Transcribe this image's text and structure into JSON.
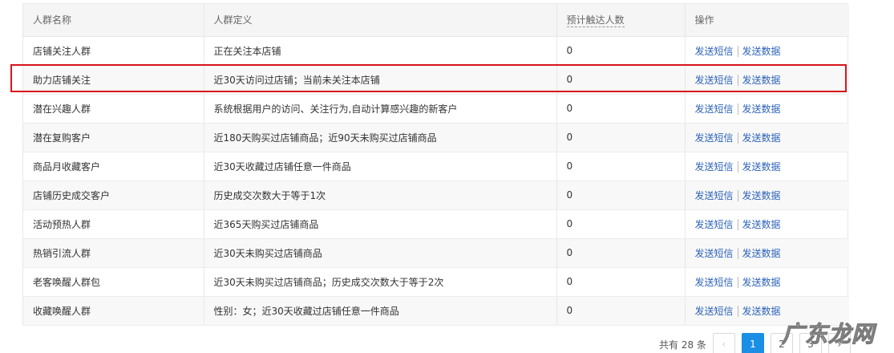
{
  "table": {
    "headers": {
      "name": "人群名称",
      "definition": "人群定义",
      "reach": "预计触达人数",
      "actions": "操作"
    },
    "rows": [
      {
        "name": "店铺关注人群",
        "definition": "正在关注本店铺",
        "reach": "0",
        "sms": "发送短信",
        "data": "发送数据"
      },
      {
        "name": "助力店铺关注",
        "definition": "近30天访问过店铺；当前未关注本店铺",
        "reach": "0",
        "sms": "发送短信",
        "data": "发送数据"
      },
      {
        "name": "潜在兴趣人群",
        "definition": "系统根据用户的访问、关注行为,自动计算感兴趣的新客户",
        "reach": "0",
        "sms": "发送短信",
        "data": "发送数据"
      },
      {
        "name": "潜在复购客户",
        "definition": "近180天购买过店铺商品；近90天未购买过店铺商品",
        "reach": "0",
        "sms": "发送短信",
        "data": "发送数据"
      },
      {
        "name": "商品月收藏客户",
        "definition": "近30天收藏过店铺任意一件商品",
        "reach": "0",
        "sms": "发送短信",
        "data": "发送数据"
      },
      {
        "name": "店铺历史成交客户",
        "definition": "历史成交次数大于等于1次",
        "reach": "0",
        "sms": "发送短信",
        "data": "发送数据"
      },
      {
        "name": "活动预热人群",
        "definition": "近365天购买过店铺商品",
        "reach": "0",
        "sms": "发送短信",
        "data": "发送数据"
      },
      {
        "name": "热销引流人群",
        "definition": "近30天未购买过店铺商品",
        "reach": "0",
        "sms": "发送短信",
        "data": "发送数据"
      },
      {
        "name": "老客唤醒人群包",
        "definition": "近30天未购买过店铺商品；历史成交次数大于等于2次",
        "reach": "0",
        "sms": "发送短信",
        "data": "发送数据"
      },
      {
        "name": "收藏唤醒人群",
        "definition": "性别：女；近30天收藏过店铺任意一件商品",
        "reach": "0",
        "sms": "发送短信",
        "data": "发送数据"
      }
    ]
  },
  "pagination": {
    "total_text": "共有 28 条",
    "prev_icon": "chevron-left-icon",
    "prev_glyph": "‹",
    "pages": [
      "1",
      "2",
      "3"
    ],
    "current_page": "1",
    "next_icon": "chevron-right-icon",
    "next_glyph": "›"
  },
  "watermark": "广东龙网",
  "colors": {
    "link": "#2c62b8",
    "highlight": "#d9131c",
    "active_page": "#1a8fe3"
  }
}
